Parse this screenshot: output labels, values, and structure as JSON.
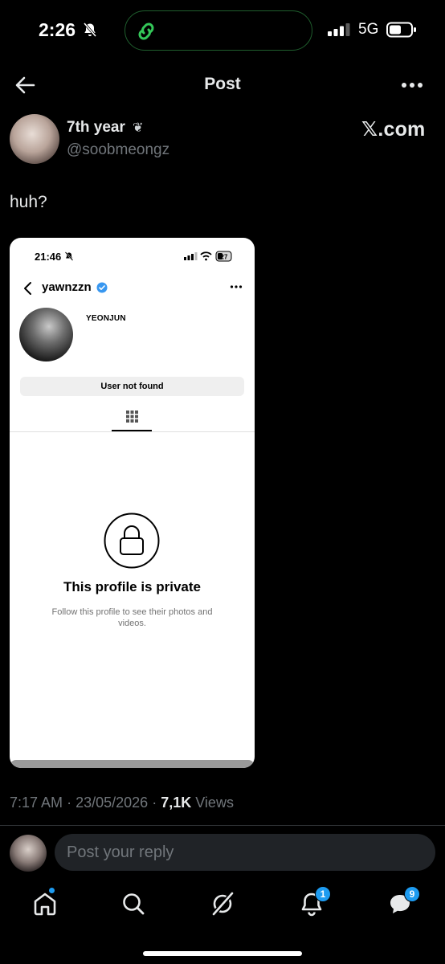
{
  "status_bar": {
    "time": "2:26",
    "network": "5G"
  },
  "header": {
    "title": "Post"
  },
  "author": {
    "display_name": "7th year",
    "name_glyph": "❦",
    "handle": "@soobmeongz",
    "source_badge": "𝕏.com"
  },
  "post": {
    "text": "huh?"
  },
  "embedded": {
    "time": "21:46",
    "battery": "27",
    "username": "yawnzzn",
    "name": "YEONJUN",
    "button_label": "User not found",
    "private_title": "This profile is private",
    "private_sub": "Follow this profile to see their photos and videos."
  },
  "meta": {
    "time": "7:17 AM",
    "date": "23/05/2026",
    "views_count": "7,1K",
    "views_label": "Views",
    "sep": "·"
  },
  "reply": {
    "placeholder": "Post your reply"
  },
  "tabbar": {
    "notifications_badge": "1",
    "messages_badge": "9"
  },
  "colors": {
    "accent": "#1d9bf0",
    "island_border": "#1f5e2d",
    "secondary_text": "#71767b"
  }
}
